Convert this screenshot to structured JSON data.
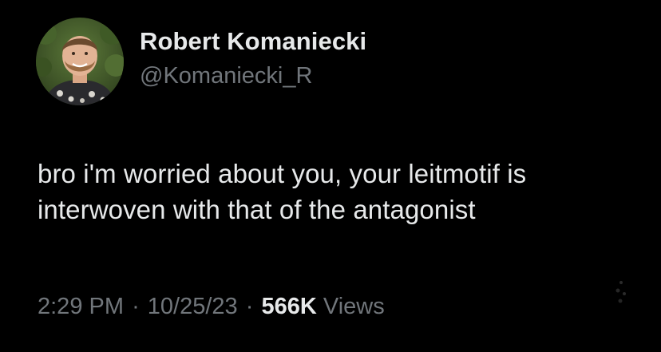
{
  "author": {
    "display_name": "Robert Komaniecki",
    "handle": "@Komaniecki_R",
    "avatar_icon": "profile-photo"
  },
  "tweet": {
    "text_lines": [
      "bro i'm worried about you, your leitmotif is",
      "interwoven with that of the antagonist"
    ]
  },
  "meta": {
    "time": "2:29 PM",
    "separator": "·",
    "date": "10/25/23",
    "views_count": "566K",
    "views_label": "Views"
  },
  "colors": {
    "background": "#000000",
    "primary_text": "#e7e9ea",
    "secondary_text": "#71767b"
  }
}
